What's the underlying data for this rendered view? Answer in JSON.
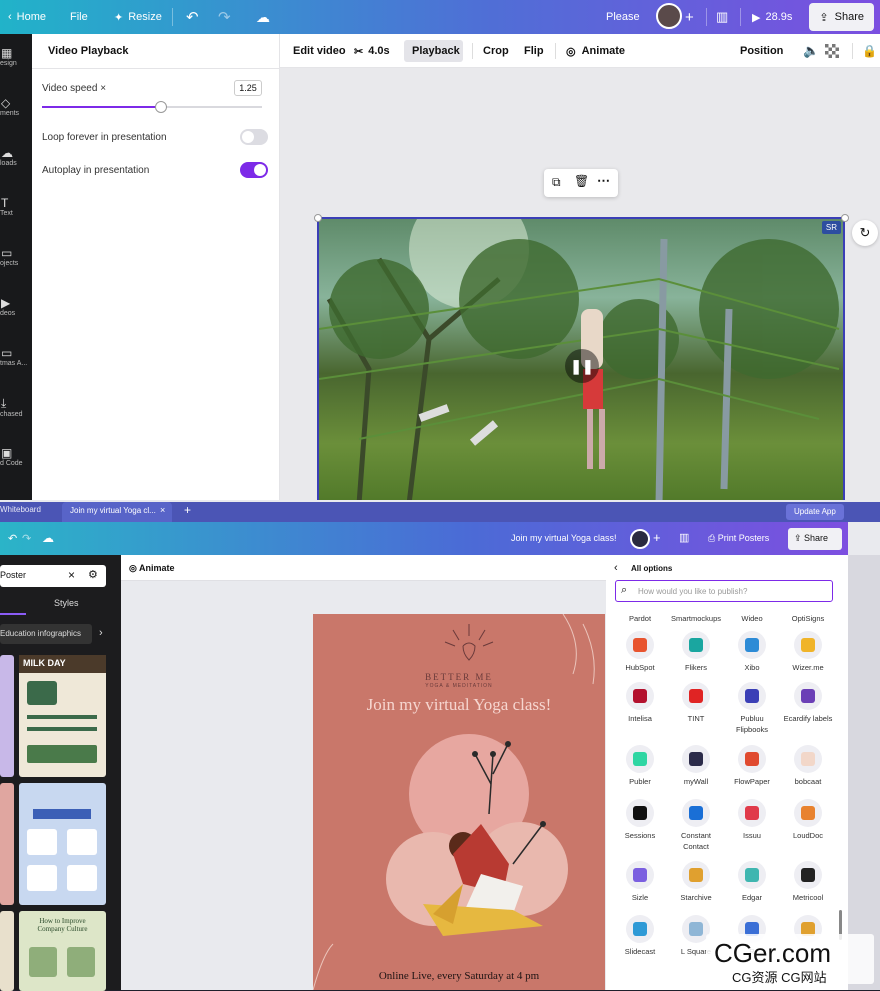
{
  "topbar": {
    "home": "Home",
    "file": "File",
    "resize": "Resize",
    "please": "Please",
    "duration": "28.9s",
    "share": "Share"
  },
  "rail": [
    "esign",
    "ments",
    "loads",
    "Text",
    "ojects",
    "deos",
    "tmas A...",
    "chased",
    "d Code"
  ],
  "panel": {
    "title": "Video Playback",
    "speed_label": "Video speed ×",
    "speed_value": "1.25",
    "speed_fraction": 0.54,
    "loop_label": "Loop forever in presentation",
    "loop_on": false,
    "autoplay_label": "Autoplay in presentation",
    "autoplay_on": true
  },
  "toolbar": {
    "edit_video": "Edit video",
    "duration": "4.0s",
    "playback": "Playback",
    "crop": "Crop",
    "flip": "Flip",
    "animate": "Animate",
    "position": "Position"
  },
  "video": {
    "badge": "SR"
  },
  "tabs": {
    "whiteboard": "Whiteboard",
    "active": "Join my virtual Yoga cl...",
    "update": "Update App"
  },
  "bar2": {
    "doc_title": "Join my virtual Yoga class!",
    "print": "Print Posters",
    "share": "Share"
  },
  "side2": {
    "search": "Poster",
    "styles": "Styles",
    "chip": "Education infographics",
    "milk": "MILK DAY",
    "improve": "How to Improve Company Culture"
  },
  "editor2": {
    "animate": "Animate"
  },
  "poster": {
    "brand": "BETTER ME",
    "tagline": "YOGA & MEDITATION",
    "title": "Join my virtual Yoga class!",
    "footer": "Online Live, every Saturday at 4 pm"
  },
  "publish": {
    "back_label": "All options",
    "search_placeholder": "How would you like to publish?",
    "header_row": [
      "Pardot",
      "Smartmockups",
      "Wideo",
      "OptiSigns"
    ],
    "rows": [
      [
        {
          "n": "HubSpot",
          "c": "#e8542f"
        },
        {
          "n": "Flikers",
          "c": "#1aa6a0"
        },
        {
          "n": "Xibo",
          "c": "#2d8bd6"
        },
        {
          "n": "Wizer.me",
          "c": "#f0b429"
        }
      ],
      [
        {
          "n": "Intelisa",
          "c": "#b3112e"
        },
        {
          "n": "TINT",
          "c": "#e02424"
        },
        {
          "n": "Publuu Flipbooks",
          "c": "#3b3fb6"
        },
        {
          "n": "Ecardify labels",
          "c": "#6b3fb6"
        }
      ],
      [
        {
          "n": "Publer",
          "c": "#2fd6a3"
        },
        {
          "n": "myWall",
          "c": "#2c2c4a"
        },
        {
          "n": "FlowPaper",
          "c": "#e04a2f"
        },
        {
          "n": "bobcaat",
          "c": "#f2d7c9"
        }
      ],
      [
        {
          "n": "Sessions",
          "c": "#111111"
        },
        {
          "n": "Constant Contact",
          "c": "#1a6fd6"
        },
        {
          "n": "Issuu",
          "c": "#e03a4a"
        },
        {
          "n": "LoudDoc",
          "c": "#e8822f"
        }
      ],
      [
        {
          "n": "Sizle",
          "c": "#7b5fe0"
        },
        {
          "n": "Starchive",
          "c": "#e0a02f"
        },
        {
          "n": "Edgar",
          "c": "#3fb6b0"
        },
        {
          "n": "Metricool",
          "c": "#222222"
        }
      ],
      [
        {
          "n": "Slidecast",
          "c": "#2f9ad6"
        },
        {
          "n": "L Square",
          "c": "#8fb6d6"
        },
        {
          "n": "R",
          "c": "#3b6fd6"
        },
        {
          "n": "",
          "c": "#e0a02f"
        }
      ]
    ]
  },
  "watermark": {
    "brand": "CGer.com",
    "sub": "CG资源 CG网站"
  }
}
